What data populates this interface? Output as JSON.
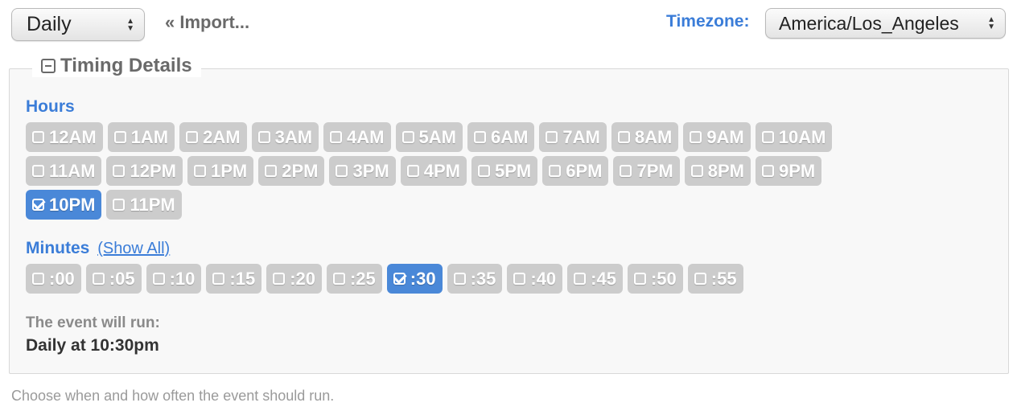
{
  "frequency": {
    "value": "Daily"
  },
  "import_link": "« Import...",
  "timezone": {
    "label": "Timezone:",
    "value": "America/Los_Angeles"
  },
  "panel": {
    "title": "Timing Details",
    "hours_label": "Hours",
    "hours_rows": [
      [
        {
          "label": "12AM",
          "checked": false
        },
        {
          "label": "1AM",
          "checked": false
        },
        {
          "label": "2AM",
          "checked": false
        },
        {
          "label": "3AM",
          "checked": false
        },
        {
          "label": "4AM",
          "checked": false
        },
        {
          "label": "5AM",
          "checked": false
        },
        {
          "label": "6AM",
          "checked": false
        },
        {
          "label": "7AM",
          "checked": false
        },
        {
          "label": "8AM",
          "checked": false
        },
        {
          "label": "9AM",
          "checked": false
        },
        {
          "label": "10AM",
          "checked": false
        }
      ],
      [
        {
          "label": "11AM",
          "checked": false
        },
        {
          "label": "12PM",
          "checked": false
        },
        {
          "label": "1PM",
          "checked": false
        },
        {
          "label": "2PM",
          "checked": false
        },
        {
          "label": "3PM",
          "checked": false
        },
        {
          "label": "4PM",
          "checked": false
        },
        {
          "label": "5PM",
          "checked": false
        },
        {
          "label": "6PM",
          "checked": false
        },
        {
          "label": "7PM",
          "checked": false
        },
        {
          "label": "8PM",
          "checked": false
        },
        {
          "label": "9PM",
          "checked": false
        }
      ],
      [
        {
          "label": "10PM",
          "checked": true
        },
        {
          "label": "11PM",
          "checked": false
        }
      ]
    ],
    "minutes_label": "Minutes",
    "show_all_link": "(Show All)",
    "minutes": [
      {
        "label": ":00",
        "checked": false
      },
      {
        "label": ":05",
        "checked": false
      },
      {
        "label": ":10",
        "checked": false
      },
      {
        "label": ":15",
        "checked": false
      },
      {
        "label": ":20",
        "checked": false
      },
      {
        "label": ":25",
        "checked": false
      },
      {
        "label": ":30",
        "checked": true
      },
      {
        "label": ":35",
        "checked": false
      },
      {
        "label": ":40",
        "checked": false
      },
      {
        "label": ":45",
        "checked": false
      },
      {
        "label": ":50",
        "checked": false
      },
      {
        "label": ":55",
        "checked": false
      }
    ],
    "summary_label": "The event will run:",
    "summary_value": "Daily at 10:30pm"
  },
  "help_text": "Choose when and how often the event should run.",
  "colors": {
    "accent": "#3b7dd8",
    "selected_chip": "#4a88d8",
    "chip": "#cccccc"
  }
}
